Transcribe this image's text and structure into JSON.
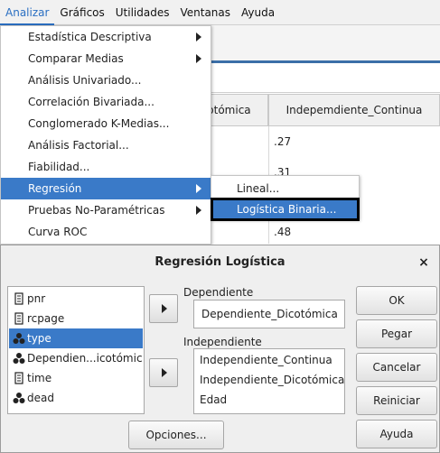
{
  "menubar": {
    "items": [
      "Analizar",
      "Gráficos",
      "Utilidades",
      "Ventanas",
      "Ayuda"
    ]
  },
  "grid": {
    "headers": [
      "icotómica",
      "Indepemdiente_Continua"
    ],
    "values": [
      ".27",
      ".31",
      ".48"
    ]
  },
  "analizar_menu": {
    "items": [
      {
        "label": "Estadística Descriptiva",
        "submenu": true
      },
      {
        "label": "Comparar Medias",
        "submenu": true
      },
      {
        "label": "Análisis Univariado...",
        "submenu": false
      },
      {
        "label": "Correlación Bivariada...",
        "submenu": false
      },
      {
        "label": "Conglomerado K-Medias...",
        "submenu": false
      },
      {
        "label": "Análisis Factorial...",
        "submenu": false
      },
      {
        "label": "Fiabilidad...",
        "submenu": false
      },
      {
        "label": "Regresión",
        "submenu": true,
        "selected": true
      },
      {
        "label": "Pruebas No-Paramétricas",
        "submenu": true
      },
      {
        "label": "Curva ROC",
        "submenu": false
      }
    ]
  },
  "regresion_submenu": {
    "items": [
      "Lineal...",
      "Logística Binaria..."
    ]
  },
  "dialog": {
    "title": "Regresión Logística",
    "close": "×",
    "variables": [
      {
        "label": "pnr",
        "icon": "scale-icon"
      },
      {
        "label": "rcpage",
        "icon": "scale-icon"
      },
      {
        "label": "type",
        "icon": "nominal-icon",
        "selected": true
      },
      {
        "label": "Dependien...icotómica",
        "icon": "nominal-icon"
      },
      {
        "label": "time",
        "icon": "scale-icon"
      },
      {
        "label": "dead",
        "icon": "nominal-icon"
      }
    ],
    "dependiente_label": "Dependiente",
    "dependiente_value": "Dependiente_Dicotómica",
    "independiente_label": "Independiente",
    "independientes": [
      "Independiente_Continua",
      "Independiente_Dicotómica",
      "Edad"
    ],
    "opciones_label": "Opciones...",
    "buttons": {
      "ok": "OK",
      "pegar": "Pegar",
      "cancelar": "Cancelar",
      "reiniciar": "Reiniciar",
      "ayuda": "Ayuda"
    }
  },
  "colors": {
    "selection": "#3a7ac8",
    "menubar_active": "#2a6fc2"
  }
}
